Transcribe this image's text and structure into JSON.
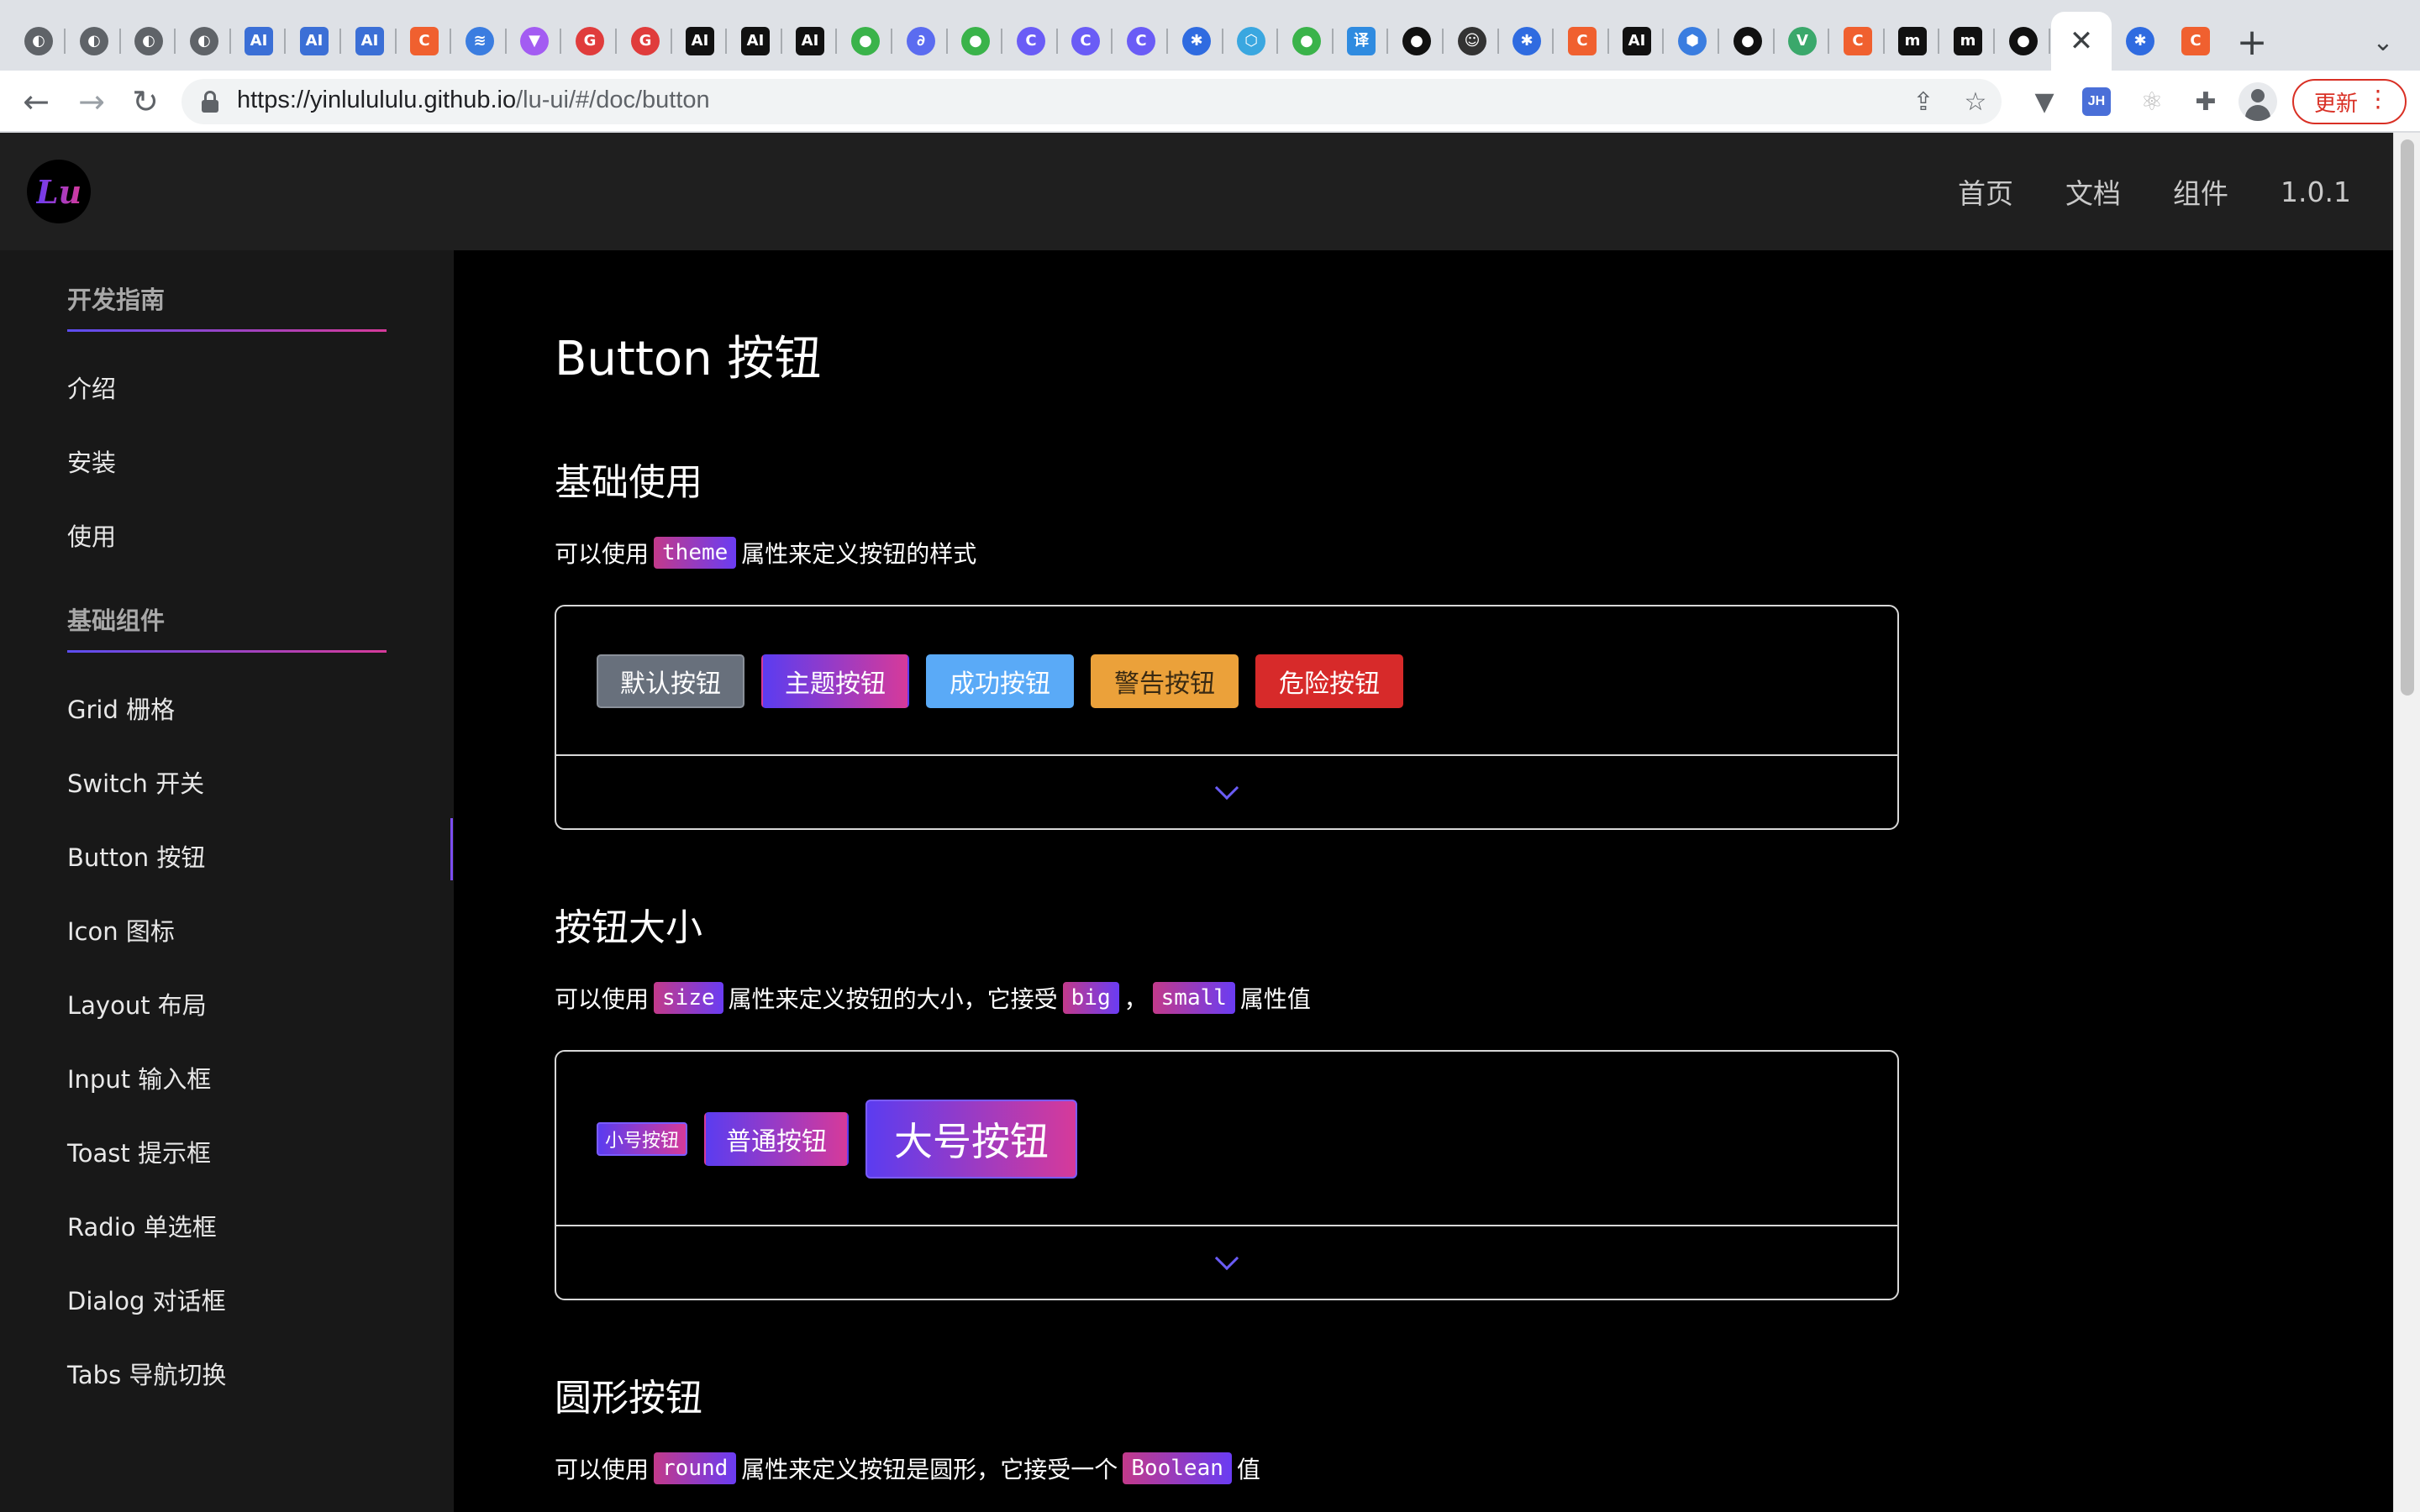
{
  "browser": {
    "tabs": [
      {
        "icon": "globe-icon",
        "color": "#5f6368",
        "glyph": "◐"
      },
      {
        "icon": "globe-icon",
        "color": "#5f6368",
        "glyph": "◐"
      },
      {
        "icon": "globe-icon",
        "color": "#5f6368",
        "glyph": "◐"
      },
      {
        "icon": "globe-icon",
        "color": "#5f6368",
        "glyph": "◐"
      },
      {
        "icon": "ai-icon",
        "color": "#3b6fd6",
        "glyph": "AI"
      },
      {
        "icon": "ai-icon",
        "color": "#3b6fd6",
        "glyph": "AI"
      },
      {
        "icon": "ai-icon",
        "color": "#3b6fd6",
        "glyph": "AI"
      },
      {
        "icon": "csdn-icon",
        "color": "#f0602f",
        "glyph": "C"
      },
      {
        "icon": "chevron-stack-icon",
        "color": "#3b7de0",
        "glyph": "≋"
      },
      {
        "icon": "vite-icon",
        "color": "#a35cf2",
        "glyph": "▼"
      },
      {
        "icon": "g-icon",
        "color": "#e03c3c",
        "glyph": "G"
      },
      {
        "icon": "g-icon",
        "color": "#e03c3c",
        "glyph": "G"
      },
      {
        "icon": "ai-black-icon",
        "color": "#111111",
        "glyph": "AI"
      },
      {
        "icon": "ai-black-icon",
        "color": "#111111",
        "glyph": "AI"
      },
      {
        "icon": "ai-black-icon",
        "color": "#111111",
        "glyph": "AI"
      },
      {
        "icon": "wechat-icon",
        "color": "#3ab34a",
        "glyph": "●"
      },
      {
        "icon": "link-icon",
        "color": "#5b6cf0",
        "glyph": "∂"
      },
      {
        "icon": "wechat-icon",
        "color": "#3ab34a",
        "glyph": "●"
      },
      {
        "icon": "circle-c-icon",
        "color": "#6a5cf6",
        "glyph": "C"
      },
      {
        "icon": "circle-c-icon",
        "color": "#6a5cf6",
        "glyph": "C"
      },
      {
        "icon": "circle-c-icon",
        "color": "#6a5cf6",
        "glyph": "C"
      },
      {
        "icon": "baidu-icon",
        "color": "#2f6be0",
        "glyph": "✱"
      },
      {
        "icon": "hex-icon",
        "color": "#3aa7e0",
        "glyph": "⬡"
      },
      {
        "icon": "wechat-icon",
        "color": "#3ab34a",
        "glyph": "●"
      },
      {
        "icon": "translate-icon",
        "color": "#2f8be0",
        "glyph": "译"
      },
      {
        "icon": "github-icon",
        "color": "#111111",
        "glyph": "●"
      },
      {
        "icon": "panda-icon",
        "color": "#333333",
        "glyph": "☺"
      },
      {
        "icon": "baidu-icon",
        "color": "#2f6be0",
        "glyph": "✱"
      },
      {
        "icon": "csdn-icon",
        "color": "#f0602f",
        "glyph": "C"
      },
      {
        "icon": "ai-black-icon",
        "color": "#111111",
        "glyph": "AI"
      },
      {
        "icon": "cube-icon",
        "color": "#3a7de0",
        "glyph": "⬢"
      },
      {
        "icon": "github-icon",
        "color": "#111111",
        "glyph": "●"
      },
      {
        "icon": "vue-icon",
        "color": "#3aa86b",
        "glyph": "V"
      },
      {
        "icon": "csdn-icon",
        "color": "#f0602f",
        "glyph": "C"
      },
      {
        "icon": "m-icon",
        "color": "#111111",
        "glyph": "m"
      },
      {
        "icon": "m-icon",
        "color": "#111111",
        "glyph": "m"
      },
      {
        "icon": "github-icon",
        "color": "#111111",
        "glyph": "●"
      }
    ],
    "active_tab_close": "✕",
    "after_tabs": [
      {
        "icon": "baidu-icon",
        "color": "#2f6be0",
        "glyph": "✱"
      },
      {
        "icon": "csdn-icon",
        "color": "#f0602f",
        "glyph": "C"
      }
    ],
    "new_tab": "+",
    "tab_search": "⌄",
    "url_host": "https://yinlulululu.github.io",
    "url_path": "/lu-ui/#/doc/button",
    "update_label": "更新",
    "update_menu": "⋮",
    "ext_badge": "JH"
  },
  "site": {
    "logo": "Lu",
    "nav": [
      {
        "label": "首页"
      },
      {
        "label": "文档"
      },
      {
        "label": "组件"
      },
      {
        "label": "1.0.1"
      }
    ]
  },
  "sidebar": {
    "groups": [
      {
        "title": "开发指南",
        "items": [
          "介绍",
          "安装",
          "使用"
        ]
      },
      {
        "title": "基础组件",
        "items": [
          "Grid 栅格",
          "Switch 开关",
          "Button 按钮",
          "Icon 图标",
          "Layout 布局",
          "Input 输入框",
          "Toast 提示框",
          "Radio 单选框",
          "Dialog 对话框",
          "Tabs 导航切换"
        ]
      }
    ],
    "active": "Button 按钮",
    "accent_from": "#5b4df0",
    "accent_to": "#d63a9a"
  },
  "main": {
    "title": "Button 按钮",
    "sections": [
      {
        "heading": "基础使用",
        "desc": [
          {
            "text": "可以使用"
          },
          {
            "code": "theme"
          },
          {
            "text": "属性来定义按钮的样式"
          }
        ],
        "buttons": [
          {
            "label": "默认按钮",
            "variant": "b-default"
          },
          {
            "label": "主题按钮",
            "variant": "b-theme"
          },
          {
            "label": "成功按钮",
            "variant": "b-success"
          },
          {
            "label": "警告按钮",
            "variant": "b-warning"
          },
          {
            "label": "危险按钮",
            "variant": "b-danger"
          }
        ]
      },
      {
        "heading": "按钮大小",
        "desc": [
          {
            "text": "可以使用"
          },
          {
            "code": "size"
          },
          {
            "text": "属性来定义按钮的大小，它接受"
          },
          {
            "code": "big"
          },
          {
            "text": "，"
          },
          {
            "code": "small"
          },
          {
            "text": "属性值"
          }
        ],
        "buttons": [
          {
            "label": "小号按钮",
            "variant": "b-small"
          },
          {
            "label": "普通按钮",
            "variant": "b-normal"
          },
          {
            "label": "大号按钮",
            "variant": "b-big"
          }
        ]
      },
      {
        "heading": "圆形按钮",
        "desc": [
          {
            "text": "可以使用"
          },
          {
            "code": "round"
          },
          {
            "text": "属性来定义按钮是圆形，它接受一个"
          },
          {
            "code": "Boolean"
          },
          {
            "text": "值"
          }
        ]
      }
    ]
  }
}
